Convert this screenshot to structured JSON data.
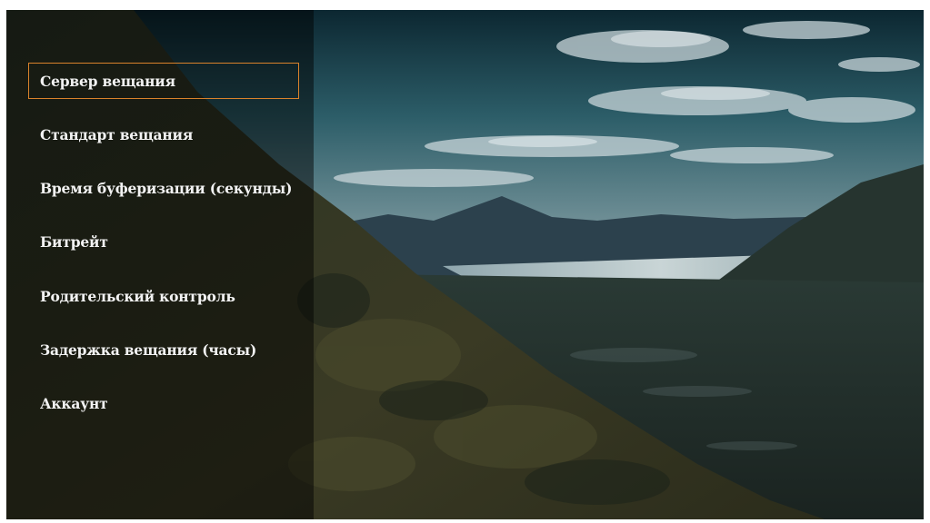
{
  "menu": {
    "selected_index": 0,
    "accent_color": "#d9822b",
    "items": [
      {
        "label": "Сервер вещания"
      },
      {
        "label": "Стандарт вещания"
      },
      {
        "label": "Время буферизации (секунды)"
      },
      {
        "label": "Битрейт"
      },
      {
        "label": "Родительский контроль"
      },
      {
        "label": "Задержка вещания (часы)"
      },
      {
        "label": "Аккаунт"
      }
    ]
  }
}
